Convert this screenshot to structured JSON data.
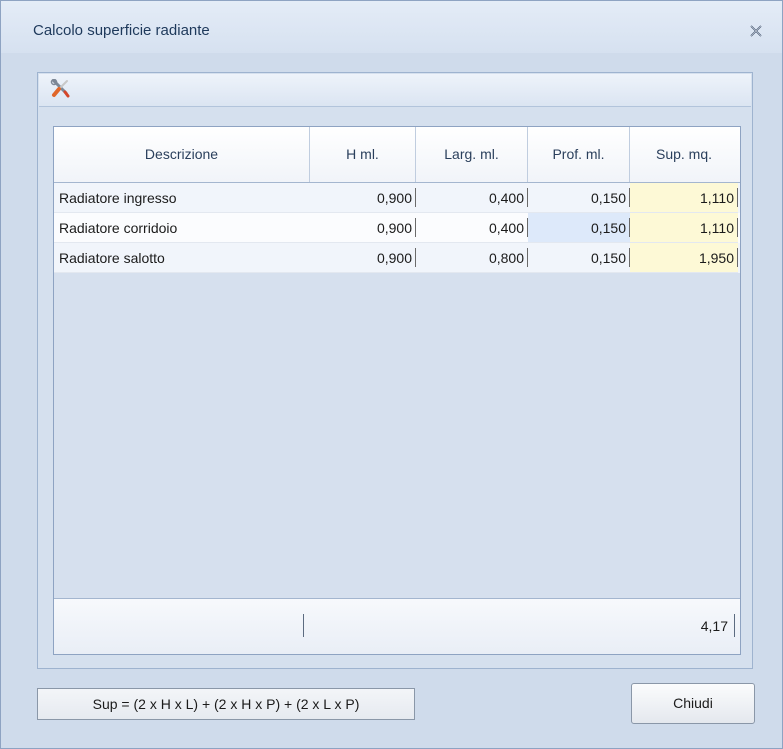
{
  "window": {
    "title": "Calcolo superficie radiante"
  },
  "icons": {
    "close": "close-icon",
    "tool": "tools-icon"
  },
  "table": {
    "columns": [
      "Descrizione",
      "H ml.",
      "Larg. ml.",
      "Prof. ml.",
      "Sup. mq."
    ],
    "rows": [
      {
        "descrizione": "Radiatore ingresso",
        "h": "0,900",
        "larg": "0,400",
        "prof": "0,150",
        "sup": "1,110"
      },
      {
        "descrizione": "Radiatore corridoio",
        "h": "0,900",
        "larg": "0,400",
        "prof": "0,150",
        "sup": "1,110"
      },
      {
        "descrizione": "Radiatore salotto",
        "h": "0,900",
        "larg": "0,800",
        "prof": "0,150",
        "sup": "1,950"
      }
    ],
    "total": "4,17"
  },
  "formula": "Sup = (2 x H x L) + (2 x H x P) + (2 x L x P)",
  "buttons": {
    "close_label": "Chiudi"
  },
  "colors": {
    "sup_highlight": "#fdf9d6",
    "selected_cell": "#dde9fa",
    "title_text": "#1e395b"
  }
}
